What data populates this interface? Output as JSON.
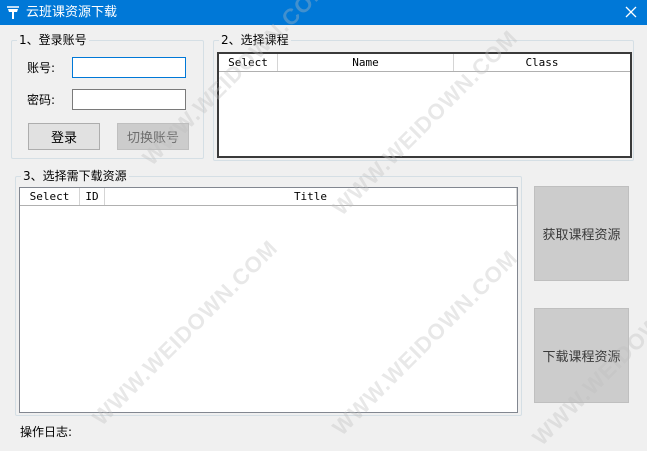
{
  "window": {
    "title": "云班课资源下载"
  },
  "login": {
    "legend": "1、登录账号",
    "account_label": "账号:",
    "password_label": "密码:",
    "account_value": "",
    "password_value": "",
    "login_button": "登录",
    "switch_button": "切换账号"
  },
  "courses": {
    "legend": "2、选择课程",
    "columns": [
      "Select",
      "Name",
      "Class"
    ]
  },
  "resources": {
    "legend": "3、选择需下载资源",
    "columns": [
      "Select",
      "ID",
      "Title"
    ]
  },
  "actions": {
    "fetch_button": "获取课程资源",
    "download_button": "下载课程资源"
  },
  "log": {
    "label": "操作日志:"
  },
  "watermark": {
    "text": "WWW.WEIDOWN.COM"
  },
  "colors": {
    "titlebar": "#0078d7",
    "window_bg": "#f0f0f0"
  }
}
